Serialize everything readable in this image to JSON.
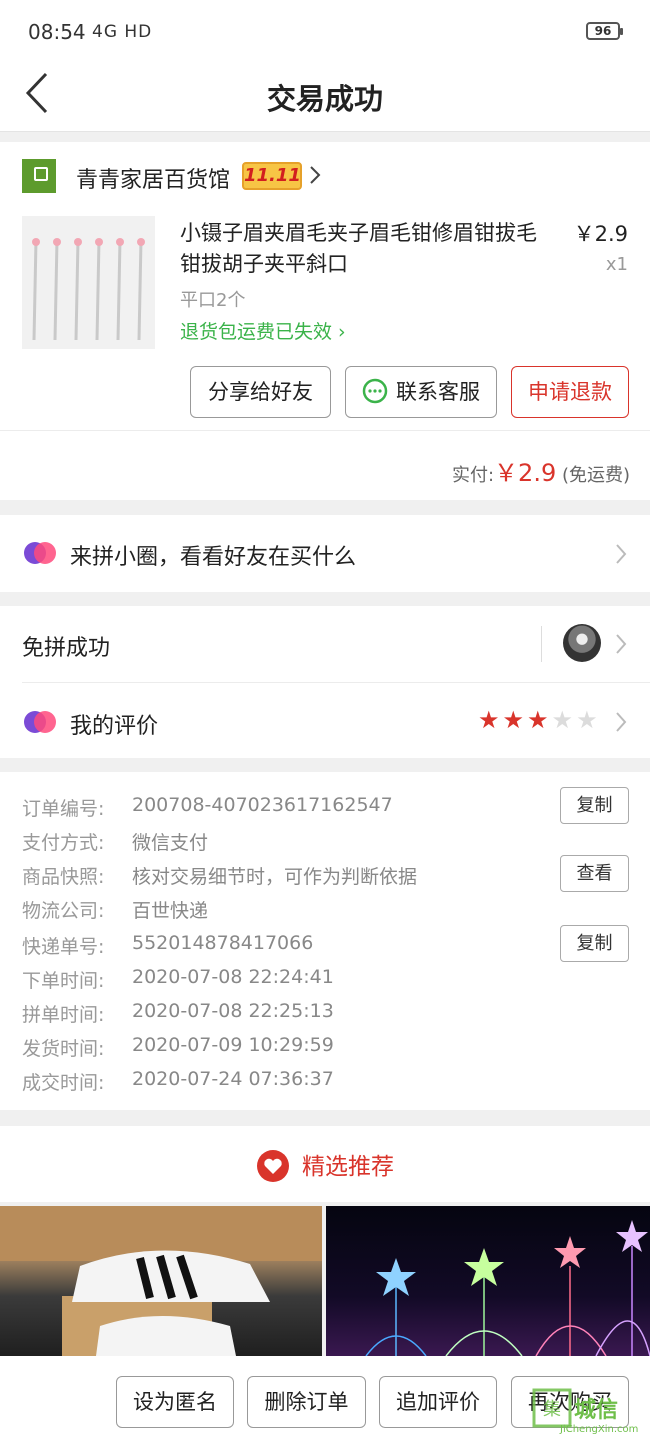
{
  "status": {
    "time": "08:54",
    "network": "4G HD",
    "battery": "96"
  },
  "nav": {
    "title": "交易成功"
  },
  "shop": {
    "name": "青青家居百货馆",
    "badge": "11.11"
  },
  "product": {
    "title": "小镊子眉夹眉毛夹子眉毛钳修眉钳拔毛钳拔胡子夹平斜口",
    "price": "￥2.9",
    "qty": "x1",
    "spec": "平口2个",
    "return_note": "退货包运费已失效"
  },
  "actions": {
    "share": "分享给好友",
    "contact": "联系客服",
    "refund": "申请退款"
  },
  "payment": {
    "label": "实付:",
    "amount": "￥2.9",
    "note": "(免运费)"
  },
  "circle": {
    "text": "来拼小圈，看看好友在买什么"
  },
  "group": {
    "text": "免拼成功"
  },
  "review": {
    "text": "我的评价",
    "rating": 3,
    "max": 5
  },
  "order_info": [
    {
      "label": "订单编号:",
      "value": "200708-407023617162547",
      "button": "复制"
    },
    {
      "label": "支付方式:",
      "value": "微信支付"
    },
    {
      "label": "商品快照:",
      "value": "核对交易细节时，可作为判断依据",
      "button": "查看"
    },
    {
      "label": "物流公司:",
      "value": "百世快递"
    },
    {
      "label": "快递单号:",
      "value": "552014878417066",
      "button": "复制"
    },
    {
      "label": "下单时间:",
      "value": "2020-07-08 22:24:41"
    },
    {
      "label": "拼单时间:",
      "value": "2020-07-08 22:25:13"
    },
    {
      "label": "发货时间:",
      "value": "2020-07-09 10:29:59"
    },
    {
      "label": "成交时间:",
      "value": "2020-07-24 07:36:37"
    }
  ],
  "recommend": {
    "title": "精选推荐"
  },
  "bottom": {
    "anonymous": "设为匿名",
    "delete": "删除订单",
    "add_review": "追加评价",
    "rebuy": "再次购买"
  },
  "watermark": {
    "text": "城信",
    "sub": "JiChengXin.com"
  },
  "colors": {
    "accent": "#d9342b",
    "green": "#3bb34a",
    "star": "#d9342b"
  }
}
